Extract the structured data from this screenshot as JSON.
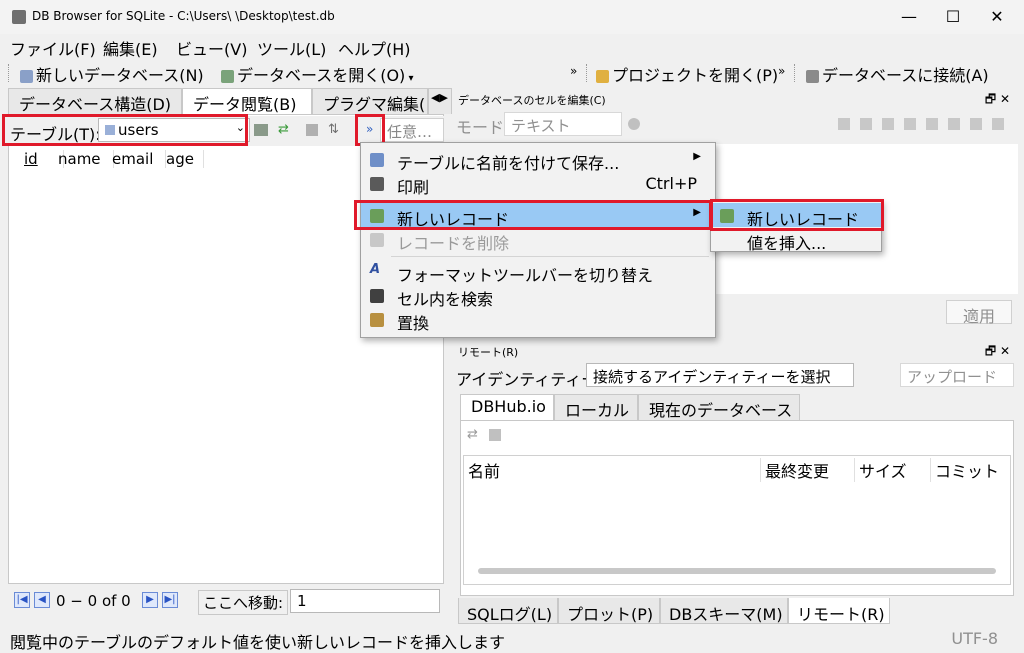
{
  "window": {
    "title": "DB Browser for SQLite - C:\\Users\\        \\Desktop\\test.db",
    "minimize": "—",
    "maximize": "☐",
    "close": "✕"
  },
  "menubar": [
    "ファイル(F)",
    "編集(E)",
    "ビュー(V)",
    "ツール(L)",
    "ヘルプ(H)"
  ],
  "toolbar": {
    "new_db": "新しいデータベース(N)",
    "open_db": "データベースを開く(O)",
    "more": "»",
    "open_project": "プロジェクトを開く(P)",
    "more2": "»",
    "connect_db": "データベースに接続(A)"
  },
  "left_tabs": [
    "データベース構造(D)",
    "データ閲覧(B)",
    "プラグマ編集("
  ],
  "filter": {
    "table_label": "テーブル(T):",
    "table_value": "users",
    "more": "»",
    "placeholder": "任意…"
  },
  "grid": {
    "columns": [
      "id",
      "name",
      "email",
      "age"
    ]
  },
  "pager": {
    "range": "0 − 0 of 0",
    "goto_label": "ここへ移動:",
    "goto_value": "1"
  },
  "edit_cell": {
    "title": "データベースのセルを編集(C)",
    "mode_label": "モード:",
    "mode_value": "テキスト",
    "apply": "適用"
  },
  "remote": {
    "title": "リモート(R)",
    "identity_label": "アイデンティティー",
    "identity_value": "接続するアイデンティティーを選択",
    "upload": "アップロード",
    "tabs": [
      "DBHub.io",
      "ローカル",
      "現在のデータベース"
    ],
    "columns": [
      "名前",
      "最終変更",
      "サイズ",
      "コミット"
    ]
  },
  "bottom_tabs": [
    "SQLログ(L)",
    "プロット(P)",
    "DBスキーマ(M)",
    "リモート(R)"
  ],
  "context_menu": {
    "items": [
      {
        "label": "テーブルに名前を付けて保存...",
        "shortcut": "",
        "submenu": true,
        "icon": "save-table-icon"
      },
      {
        "label": "印刷",
        "shortcut": "Ctrl+P",
        "submenu": false,
        "icon": "print-icon"
      },
      {
        "label": "新しいレコード",
        "shortcut": "",
        "submenu": true,
        "icon": "new-record-icon"
      },
      {
        "label": "レコードを削除",
        "shortcut": "",
        "submenu": false,
        "icon": "delete-record-icon"
      },
      {
        "label": "フォーマットツールバーを切り替え",
        "shortcut": "",
        "submenu": false,
        "icon": "format-toolbar-icon"
      },
      {
        "label": "セル内を検索",
        "shortcut": "",
        "submenu": false,
        "icon": "find-in-cell-icon"
      },
      {
        "label": "置換",
        "shortcut": "",
        "submenu": false,
        "icon": "replace-icon"
      }
    ]
  },
  "submenu": {
    "items": [
      "新しいレコード",
      "値を挿入..."
    ]
  },
  "status": {
    "message": "閲覧中のテーブルのデフォルト値を使い新しいレコードを挿入します",
    "encoding": "UTF-8"
  },
  "colors": {
    "highlight": "#99c9f4",
    "annotation_red": "#e0192a"
  }
}
